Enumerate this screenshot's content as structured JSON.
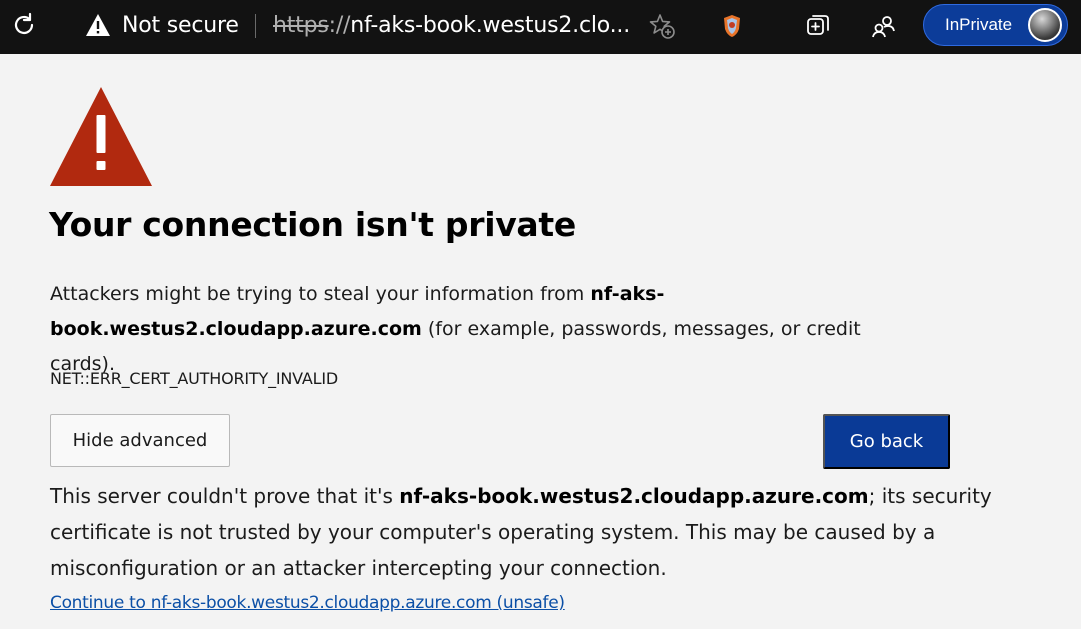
{
  "toolbar": {
    "security_label": "Not secure",
    "url_scheme": "https",
    "url_slashes": "://",
    "url_rest": "nf-aks-book.westus2.clo...",
    "inprivate_label": "InPrivate",
    "icons": [
      "refresh-icon",
      "warning-icon",
      "favorite-add-icon",
      "extension-icon",
      "collections-icon",
      "profiles-icon",
      "avatar"
    ]
  },
  "page": {
    "heading": "Your connection isn't private",
    "desc_part1": "Attackers might be trying to steal your information from ",
    "desc_host": "nf-aks-book.westus2.cloudapp.azure.com",
    "desc_part2": " (for example, passwords, messages, or credit cards).",
    "error_code": "NET::ERR_CERT_AUTHORITY_INVALID",
    "hide_advanced_label": "Hide advanced",
    "go_back_label": "Go back",
    "details_part1": "This server couldn't prove that it's ",
    "details_host": "nf-aks-book.westus2.cloudapp.azure.com",
    "details_part2": "; its security certificate is not trusted by your computer's operating system. This may be caused by a misconfiguration or an attacker intercepting your connection.",
    "proceed_link": "Continue to nf-aks-book.westus2.cloudapp.azure.com (unsafe)"
  },
  "colors": {
    "toolbar_bg": "#121212",
    "page_bg": "#f3f3f3",
    "alert_red": "#b1290f",
    "primary_button": "#0a3a96",
    "link": "#0b4fa6"
  }
}
